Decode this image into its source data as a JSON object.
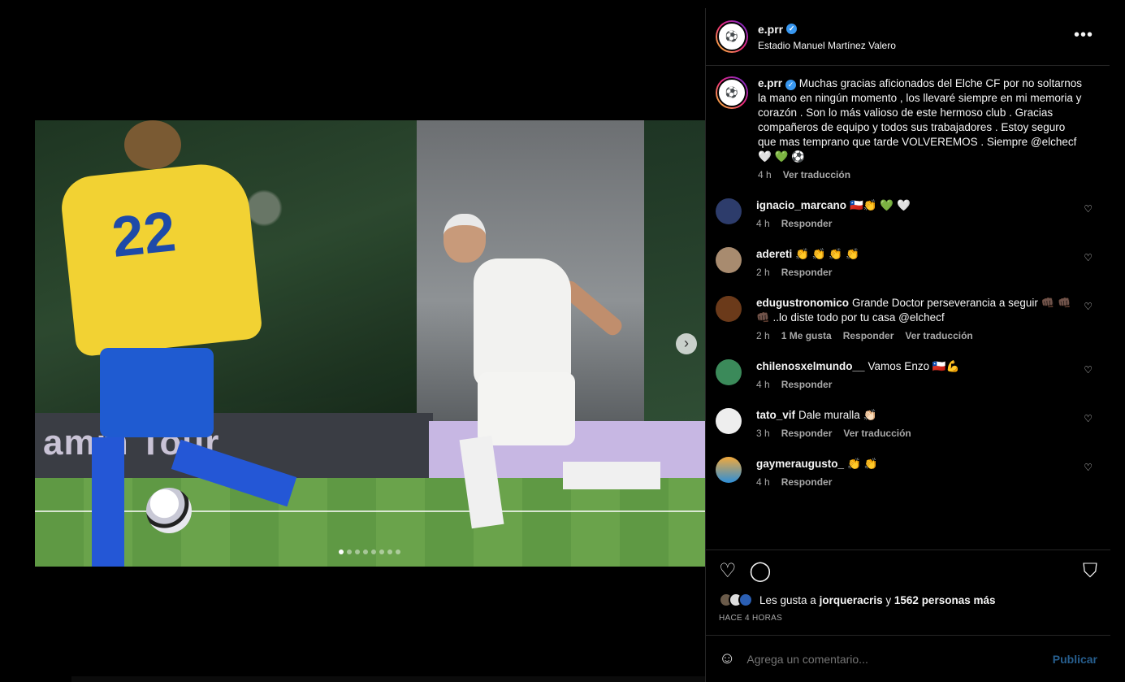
{
  "post": {
    "username": "e.prr",
    "location": "Estadio Manuel Martínez Valero",
    "caption": "Muchas gracias aficionados del Elche CF por no soltarnos la mano en ningún momento , los llevaré siempre en mi memoria y corazón . Son lo más valioso de este hermoso club . Gracias compañeros de equipo y todos sus trabajadores . Estoy seguro que mas temprano que tarde VOLVEREMOS . Siempre @elchecf",
    "caption_emoji": "🤍 💚 ⚽",
    "caption_time": "4 h",
    "translate_label": "Ver traducción"
  },
  "photo": {
    "board_text": "amm Tour",
    "player_number": "22",
    "slide_count": 8,
    "active_slide": 1
  },
  "comments": [
    {
      "user": "ignacio_marcano",
      "text": "🇨🇱👏 💚 🤍",
      "time": "4 h",
      "reply": "Responder",
      "likes": "",
      "translate": ""
    },
    {
      "user": "adereti",
      "text": "👏 👏 👏 👏",
      "time": "2 h",
      "reply": "Responder",
      "likes": "",
      "translate": ""
    },
    {
      "user": "edugustronomico",
      "text": "Grande Doctor perseverancia a seguir 👊🏿 👊🏿 👊🏿 ..lo diste todo por tu casa @elchecf",
      "time": "2 h",
      "reply": "Responder",
      "likes": "1 Me gusta",
      "translate": "Ver traducción"
    },
    {
      "user": "chilenosxelmundo__",
      "text": "Vamos Enzo 🇨🇱💪",
      "time": "4 h",
      "reply": "Responder",
      "likes": "",
      "translate": ""
    },
    {
      "user": "tato_vif",
      "text": "Dale muralla 👏🏻",
      "time": "3 h",
      "reply": "Responder",
      "likes": "",
      "translate": "Ver traducción"
    },
    {
      "user": "gaymeraugusto_",
      "text": "👏 👏",
      "time": "4 h",
      "reply": "Responder",
      "likes": "",
      "translate": ""
    }
  ],
  "footer": {
    "likes_prefix": "Les gusta a",
    "likes_user": "jorqueracris",
    "likes_connector": "y",
    "likes_count": "1562 personas más",
    "time_ago": "HACE 4 HORAS",
    "comment_placeholder": "Agrega un comentario...",
    "publish_label": "Publicar"
  },
  "icons": {
    "more": "more-options-icon",
    "like": "heart-icon",
    "comment": "comment-icon",
    "save": "bookmark-icon",
    "emoji": "emoji-icon",
    "next": "chevron-right-icon"
  },
  "colors": {
    "background": "#000000",
    "divider": "#262626",
    "muted": "#a8a8a8",
    "verified": "#3897f0",
    "publish": "#275f8f"
  }
}
